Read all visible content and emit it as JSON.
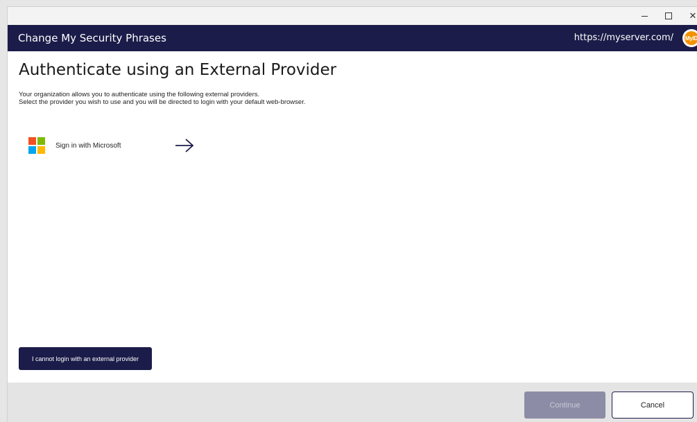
{
  "window": {
    "controls": {
      "minimize": "–",
      "maximize": "□",
      "close": "✕"
    }
  },
  "header": {
    "title": "Change My Security Phrases",
    "server_url": "https://myserver.com/",
    "logo_text": "MyID",
    "background": "#1c1c4a"
  },
  "main": {
    "title": "Authenticate using an External Provider",
    "description_lines": [
      "Your organization allows you to authenticate using the following external providers.",
      "Select the provider you wish to use and you will be directed to login with your default web-browser."
    ],
    "providers": [
      {
        "label": "Sign in with Microsoft",
        "icon": "microsoft-logo-icon",
        "logo_colors": [
          "#f25022",
          "#7fba00",
          "#00a4ef",
          "#ffb900"
        ],
        "action_icon": "arrow-right-icon"
      }
    ],
    "alt_button_label": "I cannot login with an external provider"
  },
  "footer": {
    "continue_label": "Continue",
    "continue_disabled": true,
    "cancel_label": "Cancel"
  }
}
